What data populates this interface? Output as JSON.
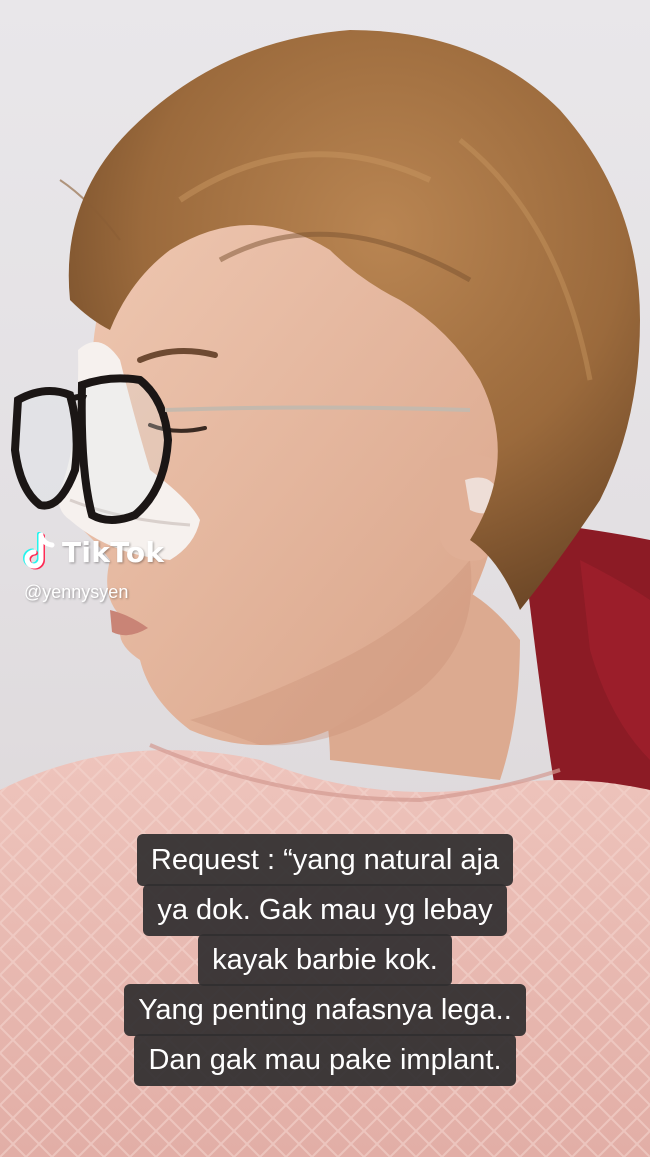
{
  "watermark": {
    "brand": "TikTok",
    "handle": "@yennysyen",
    "icon": "tiktok-note-icon"
  },
  "caption": {
    "lines": [
      "Request : “yang natural aja",
      "ya dok. Gak mau yg lebay",
      "kayak barbie kok.",
      "Yang penting nafasnya lega..",
      "Dan gak mau pake implant."
    ]
  },
  "colors": {
    "wall": "#e6e3e6",
    "hair": "#9c6b3a",
    "skin": "#e3b59d",
    "shirt": "#e7b8b0",
    "chair": "#8c1b25",
    "caption_bg": "#302e2f",
    "caption_text": "#ffffff"
  }
}
